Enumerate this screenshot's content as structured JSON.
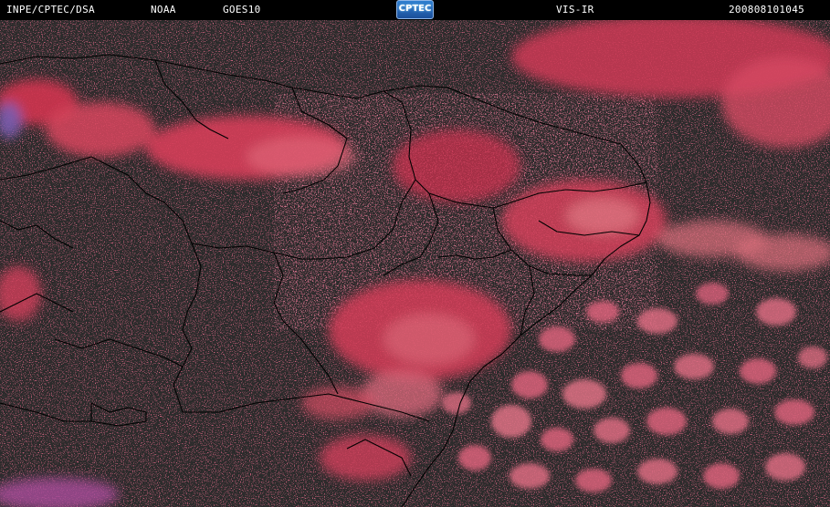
{
  "header": {
    "source": "INPE/CPTEC/DSA",
    "agency": "NOAA",
    "satellite": "GOES10",
    "logo_text": "CPTEC",
    "channel": "VIS-IR",
    "timestamp": "200808101045"
  },
  "colors": {
    "background": "#2b2b2b",
    "cloud": "#d8344f",
    "cloud_bright": "#e86a7e",
    "cloud_violet": "#b14a9a",
    "borders": "#000000"
  }
}
